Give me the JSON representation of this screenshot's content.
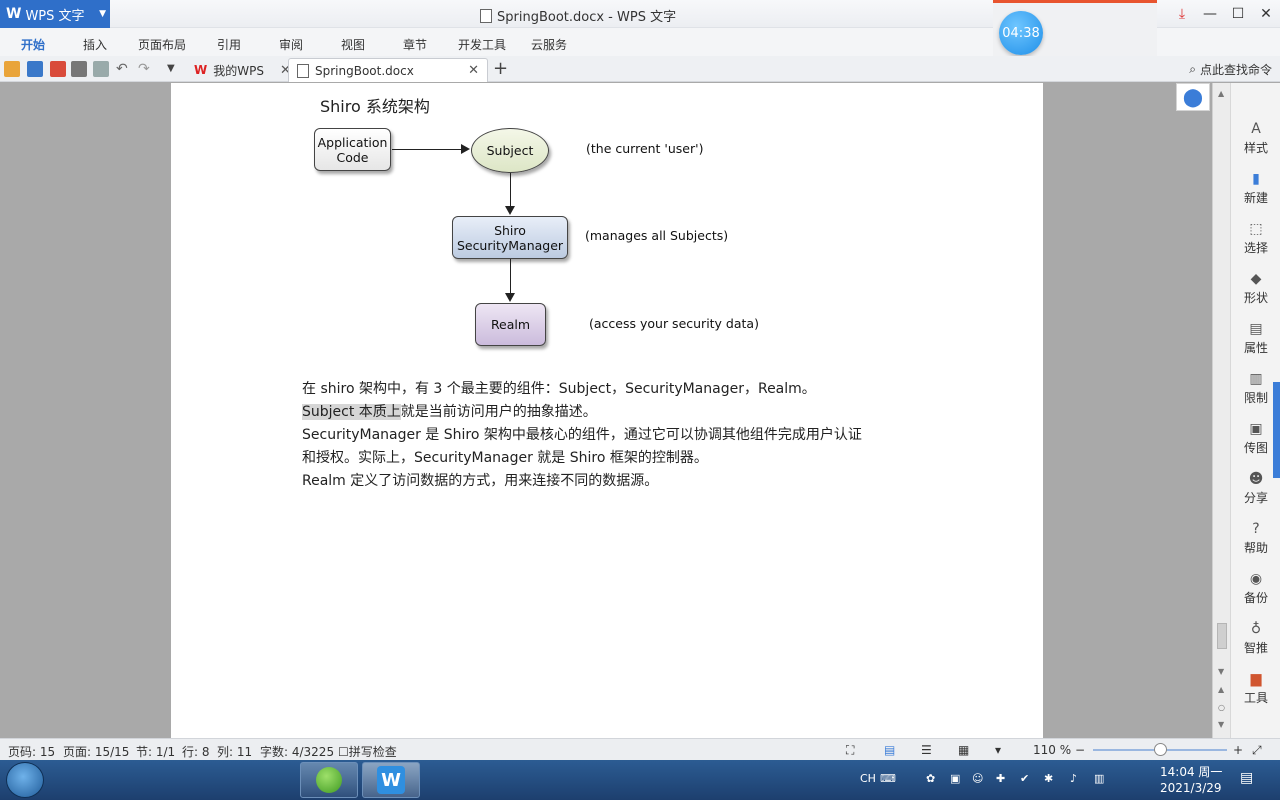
{
  "app_menu": {
    "label": "WPS 文字"
  },
  "window": {
    "title": "SpringBoot.docx - WPS 文字"
  },
  "menu_tabs": [
    "开始",
    "插入",
    "页面布局",
    "引用",
    "审阅",
    "视图",
    "章节",
    "开发工具",
    "云服务"
  ],
  "doc_tabs": [
    {
      "label": "我的WPS"
    },
    {
      "label": "SpringBoot.docx"
    }
  ],
  "search_command": {
    "label": "点此查找命令"
  },
  "timer": {
    "value": "04:38"
  },
  "document": {
    "heading": "Shiro 系统架构",
    "diagram": {
      "app_code": "Application Code",
      "subject": "Subject",
      "security_manager": "Shiro SecurityManager",
      "realm": "Realm",
      "note_subject": "(the current 'user')",
      "note_sm": "(manages all Subjects)",
      "note_realm": "(access your security data)"
    },
    "paragraphs": {
      "p1": "在 shiro 架构中，有 3 个最主要的组件：Subject，SecurityManager，Realm。",
      "p2_highlight": "Subject 本质上",
      "p2_rest": "就是当前访问用户的抽象描述。",
      "p3_line1": "SecurityManager 是 Shiro 架构中最核心的组件，通过它可以协调其他组件完成用户认证",
      "p3_line2": "和授权。实际上，SecurityManager 就是 Shiro 框架的控制器。",
      "p4": "Realm 定义了访问数据的方式，用来连接不同的数据源。"
    }
  },
  "sidebar": {
    "items": [
      "样式",
      "新建",
      "选择",
      "形状",
      "属性",
      "限制",
      "传图",
      "分享",
      "帮助",
      "备份",
      "智推",
      "工具"
    ]
  },
  "status": {
    "page_no": "页码: 15",
    "pages": "页面: 15/15",
    "section": "节: 1/1",
    "row": "行: 8",
    "col": "列: 11",
    "word_count": "字数: 4/3225",
    "spell_check": "拼写检查",
    "zoom": "110 %"
  },
  "taskbar": {
    "ime": "CH",
    "time": "14:04 周一",
    "date": "2021/3/29"
  }
}
